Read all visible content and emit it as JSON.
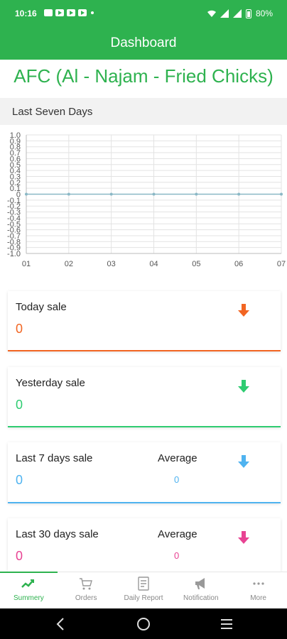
{
  "status_bar": {
    "time": "10:16",
    "battery": "80%"
  },
  "app_bar": {
    "title": "Dashboard"
  },
  "restaurant_name": "AFC (Al - Najam - Fried Chicks)",
  "section": {
    "title": "Last Seven Days"
  },
  "chart_data": {
    "type": "line",
    "title": "",
    "xlabel": "",
    "ylabel": "",
    "x": [
      "01",
      "02",
      "03",
      "04",
      "05",
      "06",
      "07"
    ],
    "y_ticks": [
      "1.0",
      "0.9",
      "0.8",
      "0.7",
      "0.6",
      "0.5",
      "0.4",
      "0.3",
      "0.2",
      "0.1",
      "0",
      "-0.1",
      "-0.2",
      "-0.3",
      "-0.4",
      "-0.5",
      "-0.6",
      "-0.7",
      "-0.8",
      "-0.9",
      "-1.0"
    ],
    "ylim": [
      -1.0,
      1.0
    ],
    "grid": true,
    "series": [
      {
        "values": [
          0,
          0,
          0,
          0,
          0,
          0,
          0
        ],
        "color": "#8ab8c6"
      }
    ]
  },
  "cards": {
    "today": {
      "label": "Today sale",
      "value": "0",
      "color": "#f26522"
    },
    "yesterday": {
      "label": "Yesterday sale",
      "value": "0",
      "color": "#2ecc71"
    },
    "last7": {
      "label": "Last 7 days sale",
      "value": "0",
      "avg_label": "Average",
      "avg_value": "0",
      "color": "#4fb3f0"
    },
    "last30": {
      "label": "Last 30 days sale",
      "value": "0",
      "avg_label": "Average",
      "avg_value": "0",
      "color": "#e84393"
    }
  },
  "bottom_nav": {
    "items": [
      {
        "label": "Summery",
        "icon": "trend-icon",
        "active": true
      },
      {
        "label": "Orders",
        "icon": "cart-icon"
      },
      {
        "label": "Daily Report",
        "icon": "report-icon"
      },
      {
        "label": "Notification",
        "icon": "megaphone-icon"
      },
      {
        "label": "More",
        "icon": "more-icon"
      }
    ]
  },
  "colors": {
    "brand": "#2eb24f"
  }
}
